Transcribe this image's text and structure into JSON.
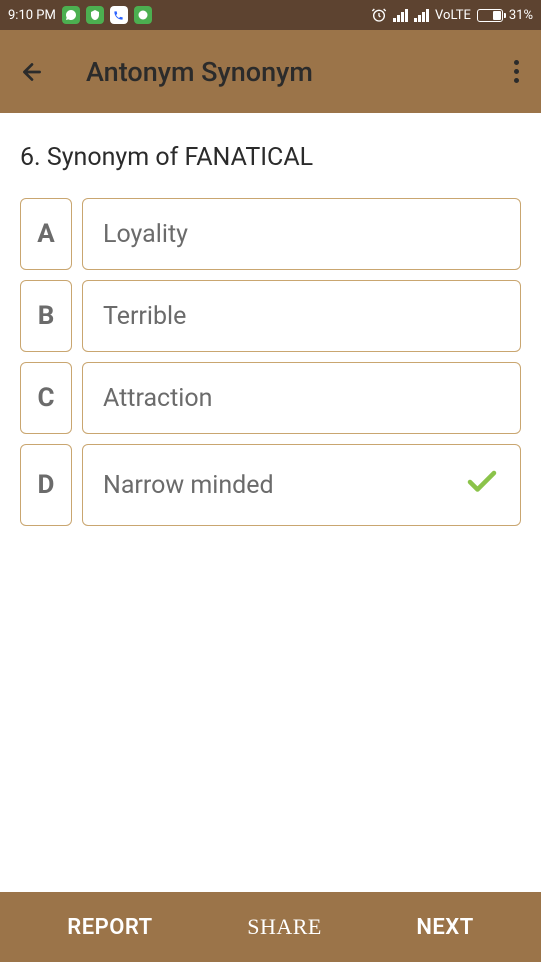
{
  "status_bar": {
    "time": "9:10 PM",
    "network_label": "VoLTE",
    "battery_percent": "31%"
  },
  "app_bar": {
    "title": "Antonym Synonym"
  },
  "question": {
    "number": "6.",
    "text": "Synonym of FANATICAL"
  },
  "options": [
    {
      "letter": "A",
      "text": "Loyality",
      "correct": false
    },
    {
      "letter": "B",
      "text": "Terrible",
      "correct": false
    },
    {
      "letter": "C",
      "text": "Attraction",
      "correct": false
    },
    {
      "letter": "D",
      "text": "Narrow minded",
      "correct": true
    }
  ],
  "bottom_bar": {
    "report": "REPORT",
    "share": "SHARE",
    "next": "NEXT"
  },
  "colors": {
    "primary": "#9b7449",
    "primary_dark": "#5d4330",
    "border": "#c9a670",
    "check": "#8bc34a"
  }
}
